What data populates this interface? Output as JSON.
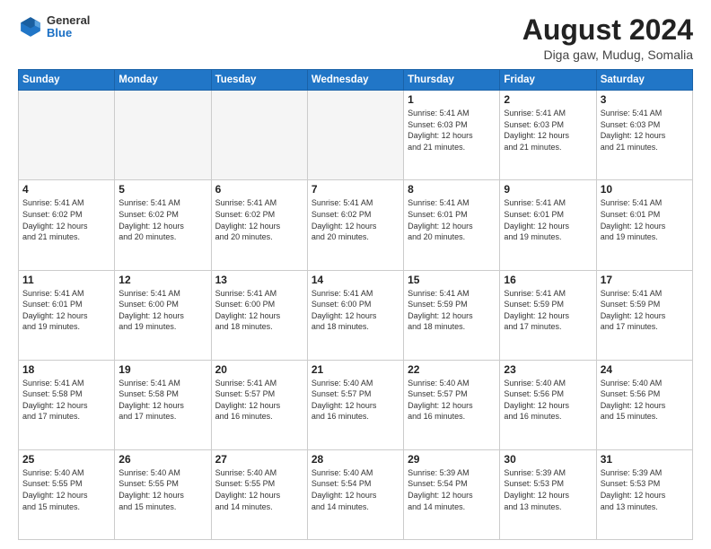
{
  "header": {
    "logo_general": "General",
    "logo_blue": "Blue",
    "month_title": "August 2024",
    "location": "Diga gaw, Mudug, Somalia"
  },
  "weekdays": [
    "Sunday",
    "Monday",
    "Tuesday",
    "Wednesday",
    "Thursday",
    "Friday",
    "Saturday"
  ],
  "weeks": [
    [
      {
        "day": "",
        "info": ""
      },
      {
        "day": "",
        "info": ""
      },
      {
        "day": "",
        "info": ""
      },
      {
        "day": "",
        "info": ""
      },
      {
        "day": "1",
        "info": "Sunrise: 5:41 AM\nSunset: 6:03 PM\nDaylight: 12 hours\nand 21 minutes."
      },
      {
        "day": "2",
        "info": "Sunrise: 5:41 AM\nSunset: 6:03 PM\nDaylight: 12 hours\nand 21 minutes."
      },
      {
        "day": "3",
        "info": "Sunrise: 5:41 AM\nSunset: 6:03 PM\nDaylight: 12 hours\nand 21 minutes."
      }
    ],
    [
      {
        "day": "4",
        "info": "Sunrise: 5:41 AM\nSunset: 6:02 PM\nDaylight: 12 hours\nand 21 minutes."
      },
      {
        "day": "5",
        "info": "Sunrise: 5:41 AM\nSunset: 6:02 PM\nDaylight: 12 hours\nand 20 minutes."
      },
      {
        "day": "6",
        "info": "Sunrise: 5:41 AM\nSunset: 6:02 PM\nDaylight: 12 hours\nand 20 minutes."
      },
      {
        "day": "7",
        "info": "Sunrise: 5:41 AM\nSunset: 6:02 PM\nDaylight: 12 hours\nand 20 minutes."
      },
      {
        "day": "8",
        "info": "Sunrise: 5:41 AM\nSunset: 6:01 PM\nDaylight: 12 hours\nand 20 minutes."
      },
      {
        "day": "9",
        "info": "Sunrise: 5:41 AM\nSunset: 6:01 PM\nDaylight: 12 hours\nand 19 minutes."
      },
      {
        "day": "10",
        "info": "Sunrise: 5:41 AM\nSunset: 6:01 PM\nDaylight: 12 hours\nand 19 minutes."
      }
    ],
    [
      {
        "day": "11",
        "info": "Sunrise: 5:41 AM\nSunset: 6:01 PM\nDaylight: 12 hours\nand 19 minutes."
      },
      {
        "day": "12",
        "info": "Sunrise: 5:41 AM\nSunset: 6:00 PM\nDaylight: 12 hours\nand 19 minutes."
      },
      {
        "day": "13",
        "info": "Sunrise: 5:41 AM\nSunset: 6:00 PM\nDaylight: 12 hours\nand 18 minutes."
      },
      {
        "day": "14",
        "info": "Sunrise: 5:41 AM\nSunset: 6:00 PM\nDaylight: 12 hours\nand 18 minutes."
      },
      {
        "day": "15",
        "info": "Sunrise: 5:41 AM\nSunset: 5:59 PM\nDaylight: 12 hours\nand 18 minutes."
      },
      {
        "day": "16",
        "info": "Sunrise: 5:41 AM\nSunset: 5:59 PM\nDaylight: 12 hours\nand 17 minutes."
      },
      {
        "day": "17",
        "info": "Sunrise: 5:41 AM\nSunset: 5:59 PM\nDaylight: 12 hours\nand 17 minutes."
      }
    ],
    [
      {
        "day": "18",
        "info": "Sunrise: 5:41 AM\nSunset: 5:58 PM\nDaylight: 12 hours\nand 17 minutes."
      },
      {
        "day": "19",
        "info": "Sunrise: 5:41 AM\nSunset: 5:58 PM\nDaylight: 12 hours\nand 17 minutes."
      },
      {
        "day": "20",
        "info": "Sunrise: 5:41 AM\nSunset: 5:57 PM\nDaylight: 12 hours\nand 16 minutes."
      },
      {
        "day": "21",
        "info": "Sunrise: 5:40 AM\nSunset: 5:57 PM\nDaylight: 12 hours\nand 16 minutes."
      },
      {
        "day": "22",
        "info": "Sunrise: 5:40 AM\nSunset: 5:57 PM\nDaylight: 12 hours\nand 16 minutes."
      },
      {
        "day": "23",
        "info": "Sunrise: 5:40 AM\nSunset: 5:56 PM\nDaylight: 12 hours\nand 16 minutes."
      },
      {
        "day": "24",
        "info": "Sunrise: 5:40 AM\nSunset: 5:56 PM\nDaylight: 12 hours\nand 15 minutes."
      }
    ],
    [
      {
        "day": "25",
        "info": "Sunrise: 5:40 AM\nSunset: 5:55 PM\nDaylight: 12 hours\nand 15 minutes."
      },
      {
        "day": "26",
        "info": "Sunrise: 5:40 AM\nSunset: 5:55 PM\nDaylight: 12 hours\nand 15 minutes."
      },
      {
        "day": "27",
        "info": "Sunrise: 5:40 AM\nSunset: 5:55 PM\nDaylight: 12 hours\nand 14 minutes."
      },
      {
        "day": "28",
        "info": "Sunrise: 5:40 AM\nSunset: 5:54 PM\nDaylight: 12 hours\nand 14 minutes."
      },
      {
        "day": "29",
        "info": "Sunrise: 5:39 AM\nSunset: 5:54 PM\nDaylight: 12 hours\nand 14 minutes."
      },
      {
        "day": "30",
        "info": "Sunrise: 5:39 AM\nSunset: 5:53 PM\nDaylight: 12 hours\nand 13 minutes."
      },
      {
        "day": "31",
        "info": "Sunrise: 5:39 AM\nSunset: 5:53 PM\nDaylight: 12 hours\nand 13 minutes."
      }
    ]
  ]
}
